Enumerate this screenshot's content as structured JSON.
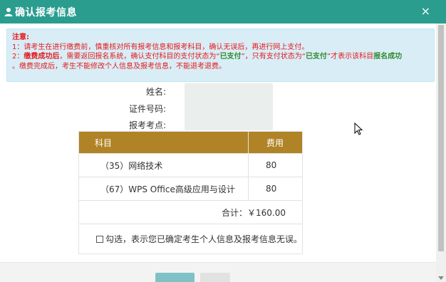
{
  "header": {
    "title": "确认报考信息",
    "close_glyph": "×",
    "user_icon": "user-icon"
  },
  "notice": {
    "heading": "注意:",
    "line1": "1：请考生在进行缴费前，慎重核对所有报考信息和报考科目，确认无误后，再进行网上支付。",
    "line2_prefix": "2：",
    "line2_bold": "缴费成功后",
    "line2_part1": "，需要返回报名系统，确认支付科目的支付状态为“",
    "status_paid_1": "已支付",
    "line2_part2": "”，只有支付状态为“",
    "status_paid_2": "已支付",
    "line2_part3": "”才表示该科目",
    "line2_bold2": "报名成功",
    "line3": "。缴费完成后，考生不能修改个人信息及报考信息，不能退考退费。"
  },
  "info": {
    "name_label": "姓名:",
    "id_label": "证件号码:",
    "site_label": "报考考点:"
  },
  "table": {
    "headers": {
      "subject": "科目",
      "fee": "费用"
    },
    "rows": [
      {
        "subject": "（35）网络技术",
        "fee": "80"
      },
      {
        "subject": "（67）WPS Office高级应用与设计",
        "fee": "80"
      }
    ],
    "total": "合计：￥160.00",
    "confirm_text": "勾选，表示您已确定考生个人信息及报考信息无误。"
  }
}
